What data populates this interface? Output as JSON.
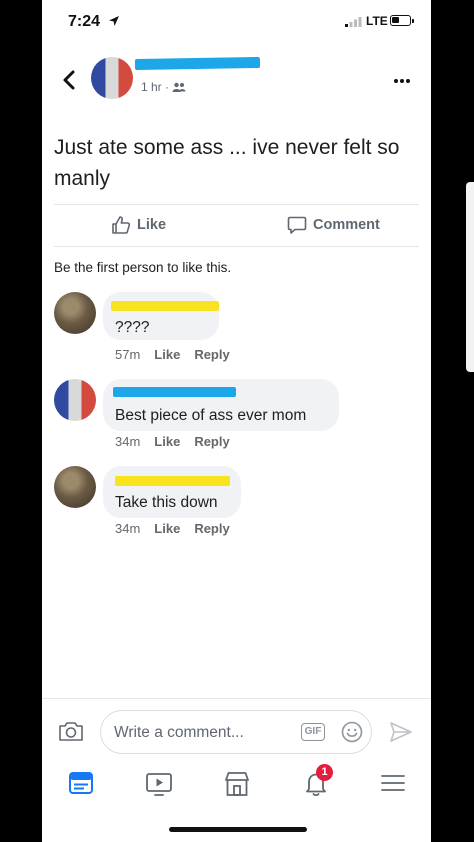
{
  "status_bar": {
    "time": "7:24",
    "network": "LTE",
    "battery_level": 0.45
  },
  "post": {
    "time": "1 hr",
    "text": "Just ate some ass ... ive never felt so manly",
    "like_label": "Like",
    "comment_label": "Comment",
    "reactions_text": "Be the first person to like this."
  },
  "comments": [
    {
      "text": "????",
      "time": "57m",
      "like": "Like",
      "reply": "Reply"
    },
    {
      "text": "Best  piece of ass ever mom",
      "time": "34m",
      "like": "Like",
      "reply": "Reply"
    },
    {
      "text": "Take this down",
      "time": "34m",
      "like": "Like",
      "reply": "Reply"
    }
  ],
  "composer": {
    "placeholder": "Write a comment...",
    "gif_label": "GIF"
  },
  "tabbar": {
    "notifications_badge": "1"
  },
  "colors": {
    "active_tab": "#1877f2",
    "icon_gray": "#606770",
    "badge": "#e41e3f",
    "redaction_blue": "#1ea7e8",
    "redaction_yellow": "#f9e21f"
  }
}
